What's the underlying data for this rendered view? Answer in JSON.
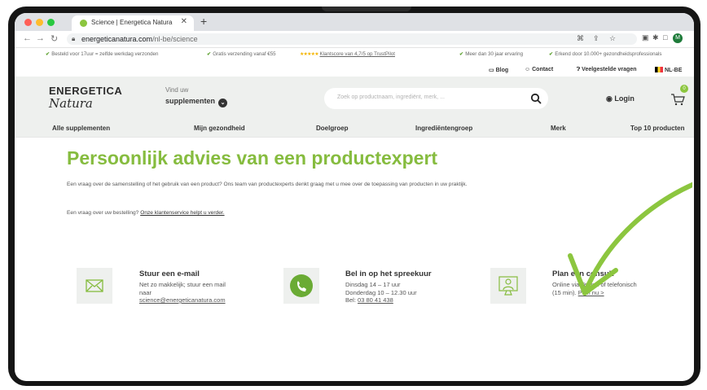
{
  "browser": {
    "tab_title": "Science | Energetica Natura",
    "url_domain": "energeticanatura.com",
    "url_path": "/nl-be/science",
    "profile_initial": "M"
  },
  "usp_bar": [
    {
      "text": "Besteld voor 17uur = zelfde werkdag verzonden"
    },
    {
      "text": "Gratis verzending vanaf €55"
    },
    {
      "text": "Klantscore van 4,7/5 op TrustPilot",
      "stars": "★★★★★"
    },
    {
      "text": "Meer dan 30 jaar ervaring"
    },
    {
      "text": "Erkend door 10.000+ gezondheidsprofessionals"
    }
  ],
  "utility": {
    "blog": "Blog",
    "contact": "Contact",
    "faq": "Veelgestelde vragen",
    "locale": "NL-BE"
  },
  "header": {
    "logo_top": "ENERGETICA",
    "logo_bottom": "Natura",
    "find_top": "Vind uw",
    "find_bottom": "supplementen",
    "search_placeholder": "Zoek op productnaam, ingrediënt, merk, ...",
    "login": "Login",
    "cart_count": "0"
  },
  "categories": [
    "Alle supplementen",
    "Mijn gezondheid",
    "Doelgroep",
    "Ingrediëntengroep",
    "Merk",
    "Top 10 producten"
  ],
  "main": {
    "title": "Persoonlijk advies van een productexpert",
    "intro": "Een vraag over de samenstelling of het gebruik van een product? Ons team van productexperts denkt graag met u mee over de toepassing van producten in uw praktijk.",
    "order_question": "Een vraag over uw bestelling?",
    "order_link": "Onze klantenservice helpt u verder."
  },
  "cards": {
    "email": {
      "title": "Stuur een e-mail",
      "line1": "Net zo makkelijk; stuur een mail",
      "line2": "naar",
      "link": "science@energeticanatura.com"
    },
    "phone": {
      "title": "Bel in op het spreekuur",
      "line1": "Dinsdag 14 – 17 uur",
      "line2": "Donderdag 10 – 12.30 uur",
      "phone_label": "Bel:",
      "phone_number": "03 80 41 438"
    },
    "consult": {
      "title": "Plan een consult",
      "line1": "Online via Teams of telefonisch",
      "line2": "(15 min).",
      "link": "Plan nu >"
    }
  },
  "colors": {
    "brand_green": "#86bc3f",
    "header_bg": "#eef0ee",
    "whatsapp_green": "#6aab34",
    "arrow_green": "#8cc63f"
  }
}
